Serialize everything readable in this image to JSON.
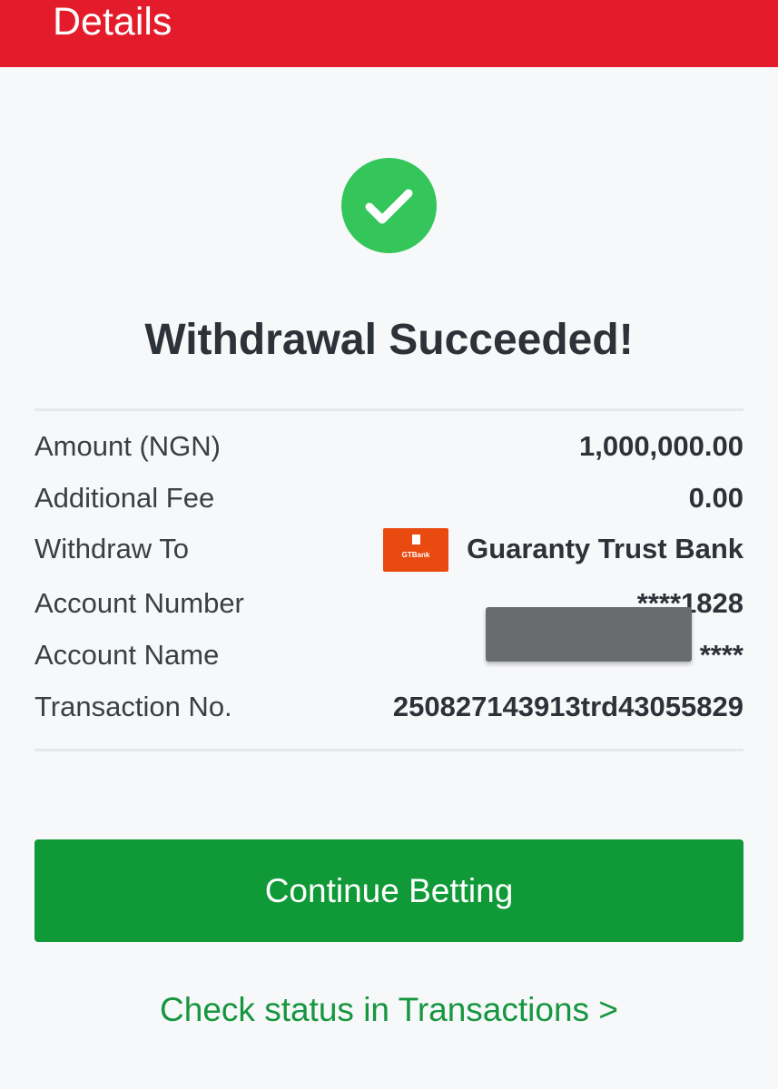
{
  "header": {
    "title": "Details",
    "color": "#e41b2a"
  },
  "result": {
    "icon": "check-icon",
    "icon_color": "#34c65a",
    "title": "Withdrawal Succeeded!"
  },
  "details": {
    "amount": {
      "label": "Amount (NGN)",
      "value": "1,000,000.00"
    },
    "fee": {
      "label": "Additional Fee",
      "value": "0.00"
    },
    "withdraw_to": {
      "label": "Withdraw To",
      "bank_logo_text": "GTBank",
      "bank_logo_color": "#e84a10",
      "value": "Guaranty Trust Bank"
    },
    "account_number": {
      "label": "Account Number",
      "value": "****1828"
    },
    "account_name": {
      "label": "Account Name",
      "value": "****"
    },
    "transaction_no": {
      "label": "Transaction No.",
      "value": "250827143913trd43055829"
    }
  },
  "actions": {
    "continue_label": "Continue Betting",
    "continue_color": "#0f9a37",
    "status_link": "Check status in Transactions >"
  }
}
